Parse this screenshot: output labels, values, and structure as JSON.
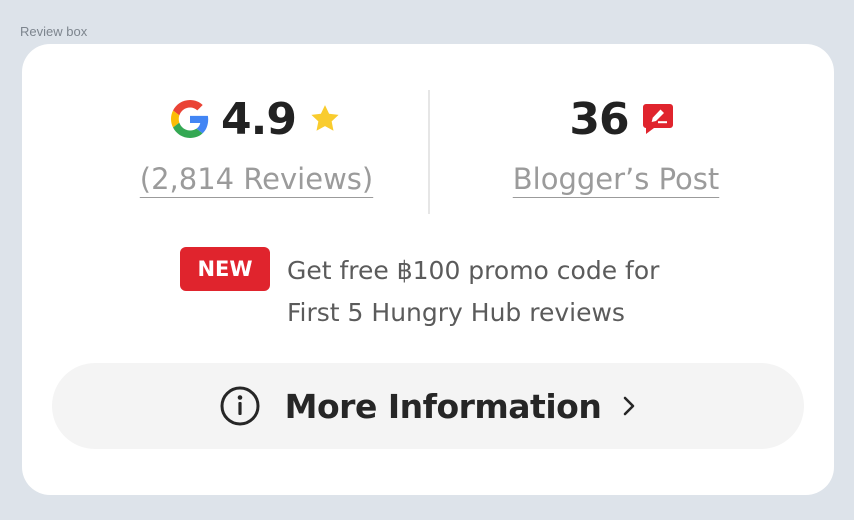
{
  "frame_label": "Review box",
  "google": {
    "icon": "google-g-icon",
    "rating": "4.9",
    "star_icon": "star-icon",
    "star_color": "#F9CC2E",
    "reviews_link": "(2,814 Reviews)"
  },
  "blogger": {
    "count": "36",
    "icon": "blogger-post-icon",
    "icon_color": "#E0242D",
    "link": "Blogger’s Post"
  },
  "promo": {
    "badge": "NEW",
    "badge_color": "#E0242D",
    "line1": "Get free ฿100 promo code for",
    "line2": "First 5 Hungry Hub reviews"
  },
  "more_button": {
    "info_icon": "info-circle-icon",
    "label": "More Information",
    "chevron_icon": "chevron-right-icon"
  }
}
